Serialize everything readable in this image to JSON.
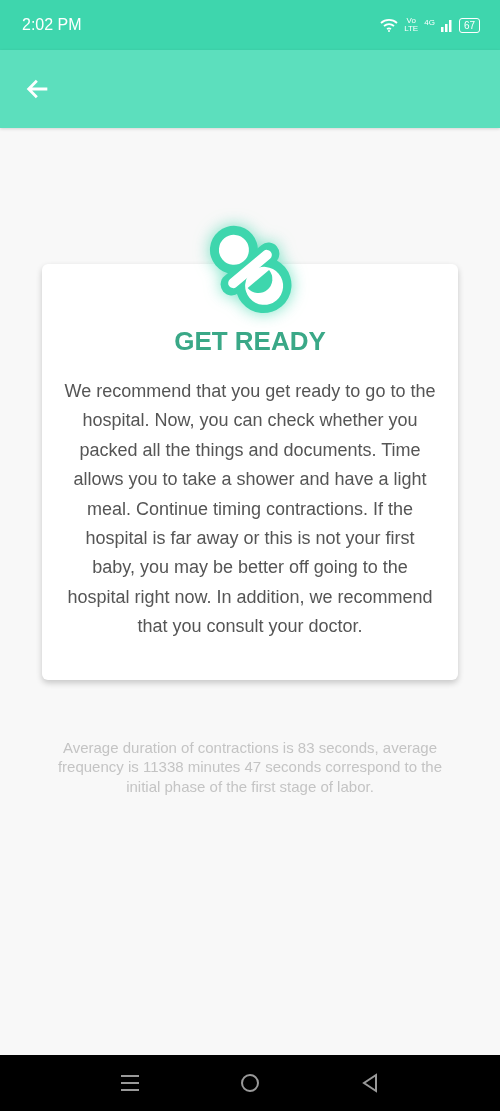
{
  "status_bar": {
    "time": "2:02 PM",
    "network_top": "Vo",
    "network_bottom": "LTE",
    "signal_label": "4G",
    "battery": "67"
  },
  "card": {
    "title": "GET READY",
    "body": "We recommend that you get ready to go to the hospital. Now, you can check whether you packed all the things and documents. Time allows you to take a shower and have a light meal. Continue timing contractions. If the hospital is far away or this is not your first baby, you may be better off going to the hospital right now. In addition, we recommend that you consult your doctor."
  },
  "summary": "Average duration of contractions is 83 seconds, average frequency is 11338 minutes 47 seconds correspond to the initial phase of the first stage of labor."
}
